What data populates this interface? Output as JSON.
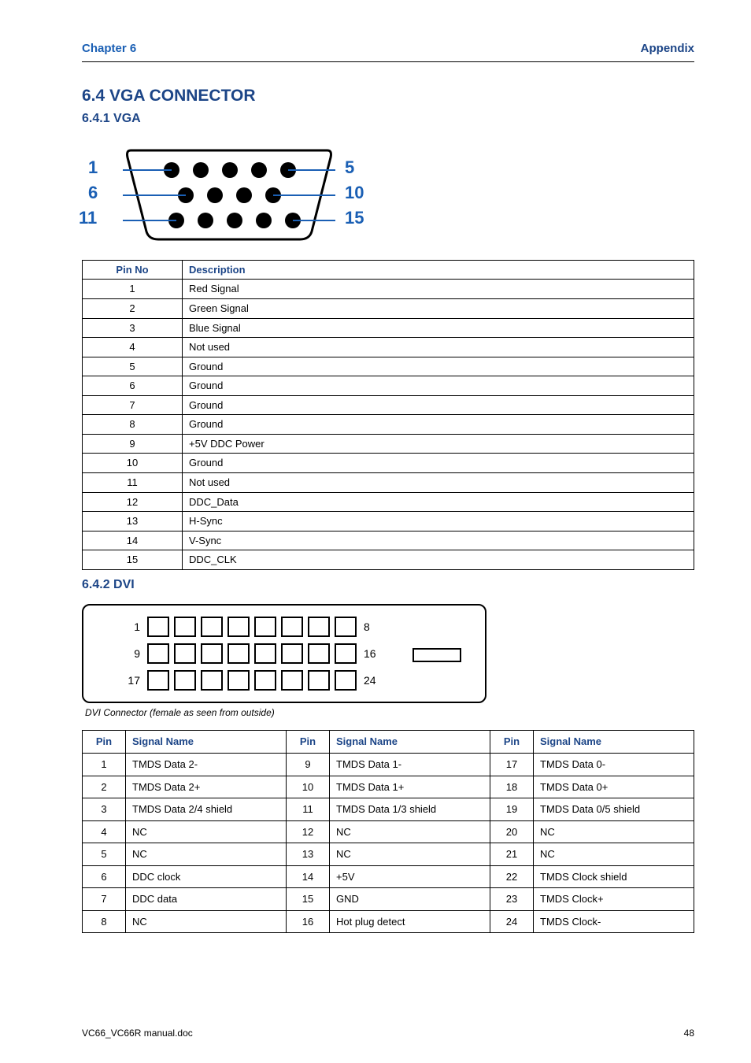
{
  "header": {
    "left": "Chapter 6",
    "right": "Appendix"
  },
  "vga": {
    "title": "6.4 VGA CONNECTOR",
    "subtitle": "6.4.1 VGA",
    "labels": {
      "l1": "1",
      "l6": "6",
      "l11": "11",
      "r5": "5",
      "r10": "10",
      "r15": "15"
    },
    "head": {
      "pin": "Pin No",
      "desc": "Description"
    },
    "rows": [
      {
        "pin": "1",
        "desc": "Red Signal"
      },
      {
        "pin": "2",
        "desc": "Green Signal"
      },
      {
        "pin": "3",
        "desc": "Blue Signal"
      },
      {
        "pin": "4",
        "desc": "Not used"
      },
      {
        "pin": "5",
        "desc": "Ground"
      },
      {
        "pin": "6",
        "desc": "Ground"
      },
      {
        "pin": "7",
        "desc": "Ground"
      },
      {
        "pin": "8",
        "desc": "Ground"
      },
      {
        "pin": "9",
        "desc": "+5V DDC Power"
      },
      {
        "pin": "10",
        "desc": "Ground"
      },
      {
        "pin": "11",
        "desc": "Not used"
      },
      {
        "pin": "12",
        "desc": "DDC_Data"
      },
      {
        "pin": "13",
        "desc": "H-Sync"
      },
      {
        "pin": "14",
        "desc": "V-Sync"
      },
      {
        "pin": "15",
        "desc": "DDC_CLK"
      }
    ]
  },
  "dvi": {
    "subtitle": "6.4.2 DVI",
    "diagram_labels": {
      "r1l": "1",
      "r1r": "8",
      "r2l": "9",
      "r2r": "16",
      "r3l": "17",
      "r3r": "24"
    },
    "caption": "DVI Connector (female as seen from outside)",
    "head": {
      "pin": "Pin",
      "name": "Signal Name"
    },
    "rows": [
      {
        "p1": "1",
        "n1": "TMDS Data 2-",
        "p2": "9",
        "n2": "TMDS Data 1-",
        "p3": "17",
        "n3": "TMDS Data 0-"
      },
      {
        "p1": "2",
        "n1": "TMDS Data 2+",
        "p2": "10",
        "n2": "TMDS Data 1+",
        "p3": "18",
        "n3": "TMDS Data 0+"
      },
      {
        "p1": "3",
        "n1": "TMDS Data 2/4 shield",
        "p2": "11",
        "n2": "TMDS Data 1/3 shield",
        "p3": "19",
        "n3": "TMDS Data 0/5 shield"
      },
      {
        "p1": "4",
        "n1": "NC",
        "p2": "12",
        "n2": "NC",
        "p3": "20",
        "n3": "NC"
      },
      {
        "p1": "5",
        "n1": "NC",
        "p2": "13",
        "n2": "NC",
        "p3": "21",
        "n3": "NC"
      },
      {
        "p1": "6",
        "n1": "DDC clock",
        "p2": "14",
        "n2": "+5V",
        "p3": "22",
        "n3": "TMDS Clock shield"
      },
      {
        "p1": "7",
        "n1": "DDC data",
        "p2": "15",
        "n2": "GND",
        "p3": "23",
        "n3": "TMDS Clock+"
      },
      {
        "p1": "8",
        "n1": "NC",
        "p2": "16",
        "n2": "Hot plug detect",
        "p3": "24",
        "n3": "TMDS Clock-"
      }
    ]
  },
  "footer": {
    "left": "VC66_VC66R manual.doc",
    "right": "48"
  }
}
